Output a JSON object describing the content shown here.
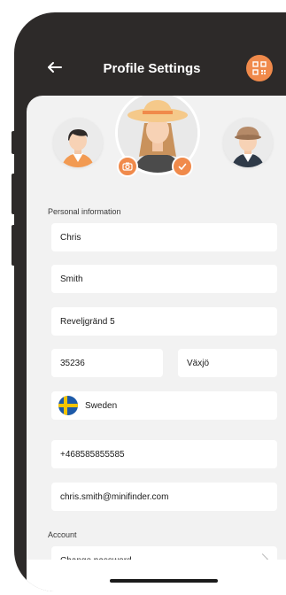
{
  "header": {
    "title": "Profile Settings",
    "back_icon": "arrow-left-icon",
    "qr_icon": "qr-code-icon"
  },
  "colors": {
    "accent": "#f08a4b",
    "frame": "#2d2a29",
    "background": "#f2f2f2"
  },
  "avatars": {
    "left": "avatar-man-dark-hair",
    "main": "avatar-woman-sun-hat",
    "right": "avatar-man-detective-hat",
    "camera_badge_icon": "camera-icon",
    "selected_badge_icon": "check-icon"
  },
  "personal": {
    "section_label": "Personal information",
    "first_name": "Chris",
    "last_name": "Smith",
    "street": "Reveljgränd 5",
    "postal_code": "35236",
    "city": "Växjö",
    "country": "Sweden",
    "country_flag_icon": "sweden-flag-icon",
    "phone": "+468585855585",
    "email": "chris.smith@minifinder.com"
  },
  "account": {
    "section_label": "Account",
    "change_password": "Change password"
  }
}
